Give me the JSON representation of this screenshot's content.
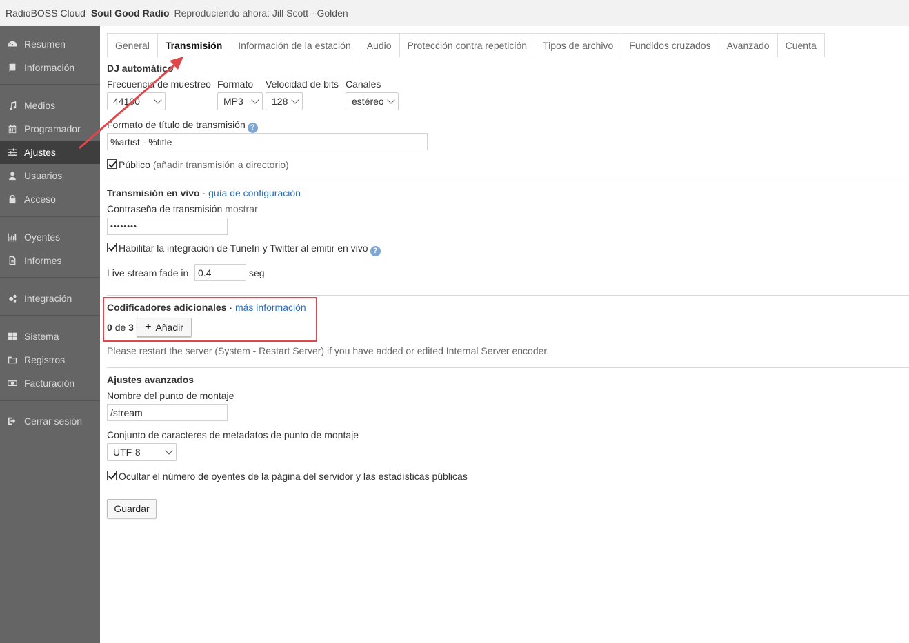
{
  "topbar": {
    "app_name": "RadioBOSS Cloud",
    "station": "Soul Good Radio",
    "now_playing": "Reproduciendo ahora: Jill Scott - Golden"
  },
  "sidebar": {
    "items": [
      {
        "label": "Resumen",
        "icon": "dashboard-icon"
      },
      {
        "label": "Información",
        "icon": "book-icon"
      },
      {
        "label": "Medios",
        "icon": "music-icon"
      },
      {
        "label": "Programador",
        "icon": "calendar-icon"
      },
      {
        "label": "Ajustes",
        "icon": "sliders-icon",
        "active": true
      },
      {
        "label": "Usuarios",
        "icon": "user-icon"
      },
      {
        "label": "Acceso",
        "icon": "lock-icon"
      },
      {
        "label": "Oyentes",
        "icon": "bar-chart-icon"
      },
      {
        "label": "Informes",
        "icon": "file-icon"
      },
      {
        "label": "Integración",
        "icon": "gears-icon"
      },
      {
        "label": "Sistema",
        "icon": "grid-icon"
      },
      {
        "label": "Registros",
        "icon": "folder-icon"
      },
      {
        "label": "Facturación",
        "icon": "money-icon"
      },
      {
        "label": "Cerrar sesión",
        "icon": "sign-out-icon"
      }
    ]
  },
  "tabs": [
    {
      "label": "General"
    },
    {
      "label": "Transmisión",
      "active": true
    },
    {
      "label": "Información de la estación"
    },
    {
      "label": "Audio"
    },
    {
      "label": "Protección contra repetición"
    },
    {
      "label": "Tipos de archivo"
    },
    {
      "label": "Fundidos cruzados"
    },
    {
      "label": "Avanzado"
    },
    {
      "label": "Cuenta"
    }
  ],
  "autodj": {
    "heading": "DJ automático",
    "sample_rate_label": "Frecuencia de muestreo",
    "format_label": "Formato",
    "bitrate_label": "Velocidad de bits",
    "channels_label": "Canales",
    "sample_rate_value": "44100",
    "format_value": "MP3",
    "bitrate_value": "128",
    "channels_value": "estéreo",
    "title_format_label": "Formato de título de transmisión",
    "title_format_value": "%artist - %title",
    "public_label": "Público",
    "public_note": "(añadir transmisión a directorio)"
  },
  "live": {
    "heading": "Transmisión en vivo",
    "separator": "·",
    "guide_link": "guía de configuración",
    "password_label": "Contraseña de transmisión",
    "show_link": "mostrar",
    "password_value": "••••••••",
    "tunein_label": "Habilitar la integración de TuneIn y Twitter al emitir en vivo",
    "fade_label": "Live stream fade in",
    "fade_value": "0.4",
    "fade_unit": "seg"
  },
  "encoders": {
    "heading": "Codificadores adicionales",
    "separator": "·",
    "more_link": "más información",
    "count": "0",
    "of": "de",
    "max": "3",
    "add_button": "Añadir",
    "restart_note": "Please restart the server (System - Restart Server) if you have added or edited Internal Server encoder."
  },
  "advanced": {
    "heading": "Ajustes avanzados",
    "mount_label": "Nombre del punto de montaje",
    "mount_value": "/stream",
    "charset_label": "Conjunto de caracteres de metadatos de punto de montaje",
    "charset_value": "UTF-8",
    "hide_listeners_label": "Ocultar el número de oyentes de la página del servidor y las estadísticas públicas"
  },
  "save_button": "Guardar",
  "colors": {
    "annotation": "#e0474c",
    "link": "#2a6ebb",
    "sidebar": "#656565"
  }
}
